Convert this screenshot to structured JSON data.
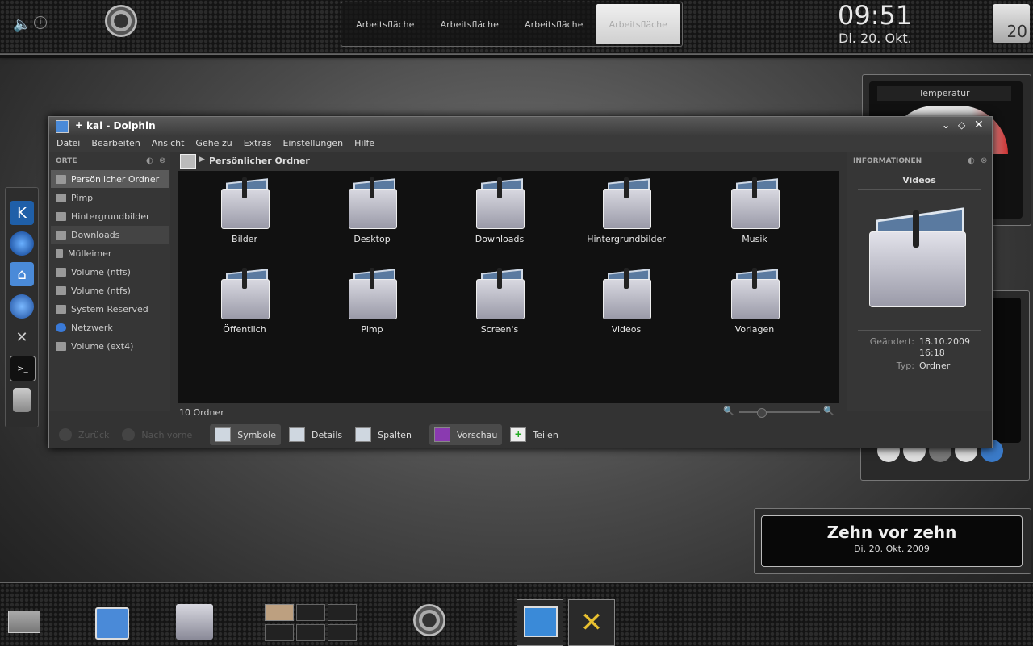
{
  "top_panel": {
    "desktops": [
      "Arbeitsfläche",
      "Arbeitsfläche",
      "Arbeitsfläche",
      "Arbeitsfläche"
    ],
    "active_desktop": 3,
    "clock_time": "09:51",
    "clock_date": "Di. 20. Okt.",
    "temperature": "20"
  },
  "window": {
    "title": "kai - Dolphin",
    "menu": [
      "Datei",
      "Bearbeiten",
      "Ansicht",
      "Gehe zu",
      "Extras",
      "Einstellungen",
      "Hilfe"
    ],
    "places_header": "ORTE",
    "places": [
      "Persönlicher Ordner",
      "Pimp",
      "Hintergrundbilder",
      "Downloads",
      "Mülleimer",
      "Volume (ntfs)",
      "Volume (ntfs)",
      "System Reserved",
      "Netzwerk",
      "Volume (ext4)"
    ],
    "breadcrumb": "Persönlicher Ordner",
    "folders": [
      "Bilder",
      "Desktop",
      "Downloads",
      "Hintergrundbilder",
      "Musik",
      "Öffentlich",
      "Pimp",
      "Screen's",
      "Videos",
      "Vorlagen"
    ],
    "status": "10 Ordner",
    "info_header": "INFORMATIONEN",
    "info_name": "Videos",
    "info_modified_label": "Geändert:",
    "info_modified_date": "18.10.2009",
    "info_modified_time": "16:18",
    "info_type_label": "Typ:",
    "info_type": "Ordner",
    "nav_back": "Zurück",
    "nav_forward": "Nach vorne",
    "views": [
      "Symbole",
      "Details",
      "Spalten"
    ],
    "preview": "Vorschau",
    "share": "Teilen"
  },
  "temp_widget": {
    "title": "Temperatur"
  },
  "clock_widget": {
    "text": "Zehn vor zehn",
    "date": "Di. 20. Okt. 2009"
  }
}
